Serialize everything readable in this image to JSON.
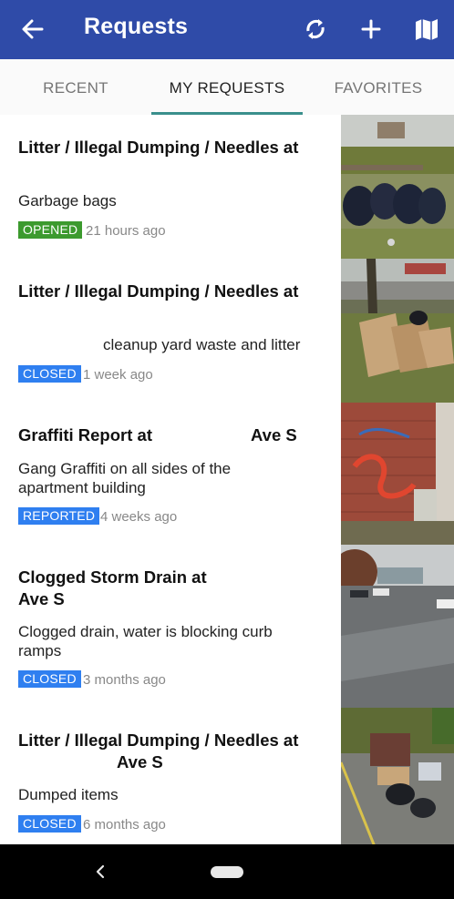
{
  "appbar": {
    "title": "Requests",
    "icons": [
      "arrow-back-icon",
      "refresh-icon",
      "add-icon",
      "map-icon"
    ],
    "color": "#2f4ba8"
  },
  "tabs": [
    {
      "label": "RECENT",
      "active": false
    },
    {
      "label": "MY REQUESTS",
      "active": true
    },
    {
      "label": "FAVORITES",
      "active": false
    }
  ],
  "requests": [
    {
      "title_lines": [
        "Litter / Illegal Dumping / Needles at",
        ""
      ],
      "description": "Garbage bags",
      "status": "OPENED",
      "status_color": "#3c9a2e",
      "time": "21 hours ago"
    },
    {
      "title_lines": [
        "Litter / Illegal Dumping / Needles at",
        ""
      ],
      "description": "cleanup yard waste and litter",
      "status": "CLOSED",
      "status_color": "#2f7ff0",
      "time": "1 week ago"
    },
    {
      "title_lines": [
        "Graffiti Report at",
        "Ave S"
      ],
      "description": "Gang Graffiti on all sides of the apartment building",
      "status": "REPORTED",
      "status_color": "#2f7ff0",
      "time": "4 weeks ago"
    },
    {
      "title_lines": [
        "Clogged Storm Drain at",
        "Ave S"
      ],
      "description": "Clogged drain, water is blocking curb ramps",
      "status": "CLOSED",
      "status_color": "#2f7ff0",
      "time": "3 months ago"
    },
    {
      "title_lines": [
        "Litter / Illegal Dumping / Needles at",
        "Ave S"
      ],
      "description": "Dumped items",
      "status": "CLOSED",
      "status_color": "#2f7ff0",
      "time": "6 months ago"
    }
  ],
  "system_nav": {
    "icons": [
      "nav-back-icon",
      "home-pill-icon"
    ]
  }
}
